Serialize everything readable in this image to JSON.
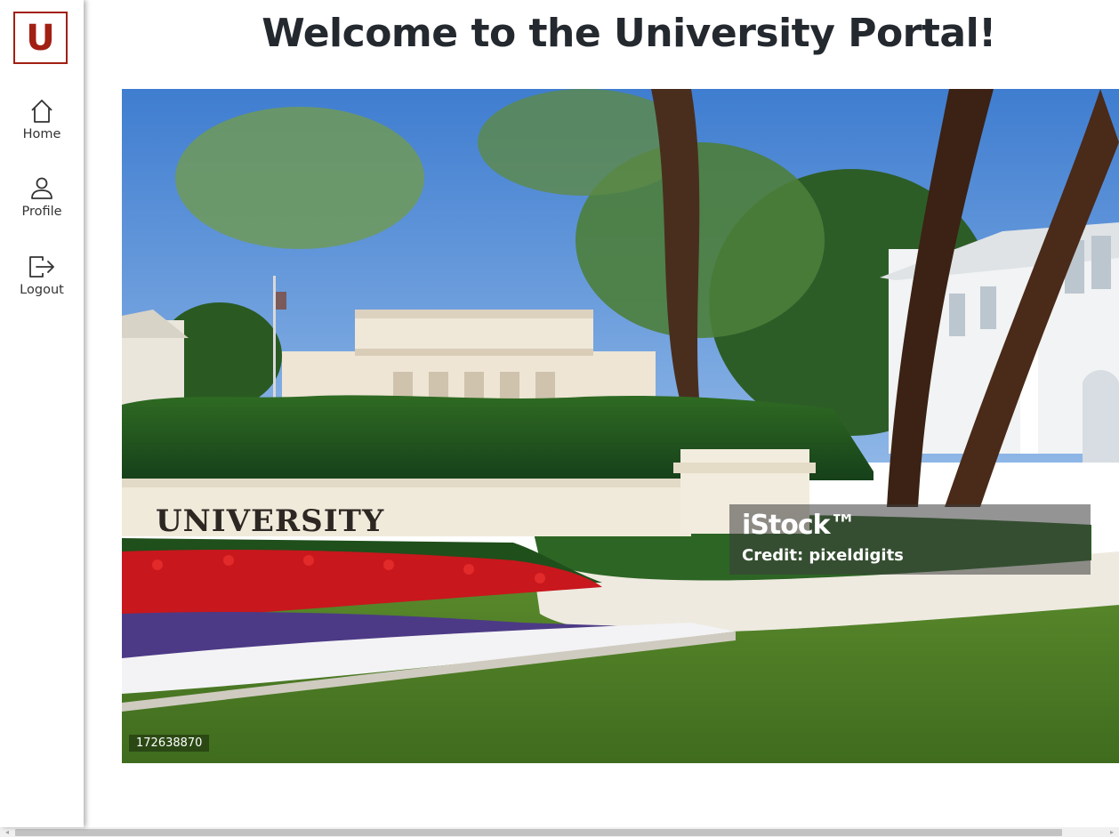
{
  "logo": {
    "letter": "U",
    "color": "#a11f13"
  },
  "sidebar": {
    "items": [
      {
        "label": "Home",
        "icon": "home-icon"
      },
      {
        "label": "Profile",
        "icon": "user-icon"
      },
      {
        "label": "Logout",
        "icon": "logout-icon"
      }
    ]
  },
  "main": {
    "title": "Welcome to the University Portal!"
  },
  "hero_image": {
    "sign_text": "UNIVERSITY",
    "watermark": {
      "brand": "iStock™",
      "credit": "Credit: pixeldigits"
    },
    "image_id": "172638870"
  },
  "scrollbar": {
    "left_arrow": "◂",
    "right_arrow": "▸"
  }
}
